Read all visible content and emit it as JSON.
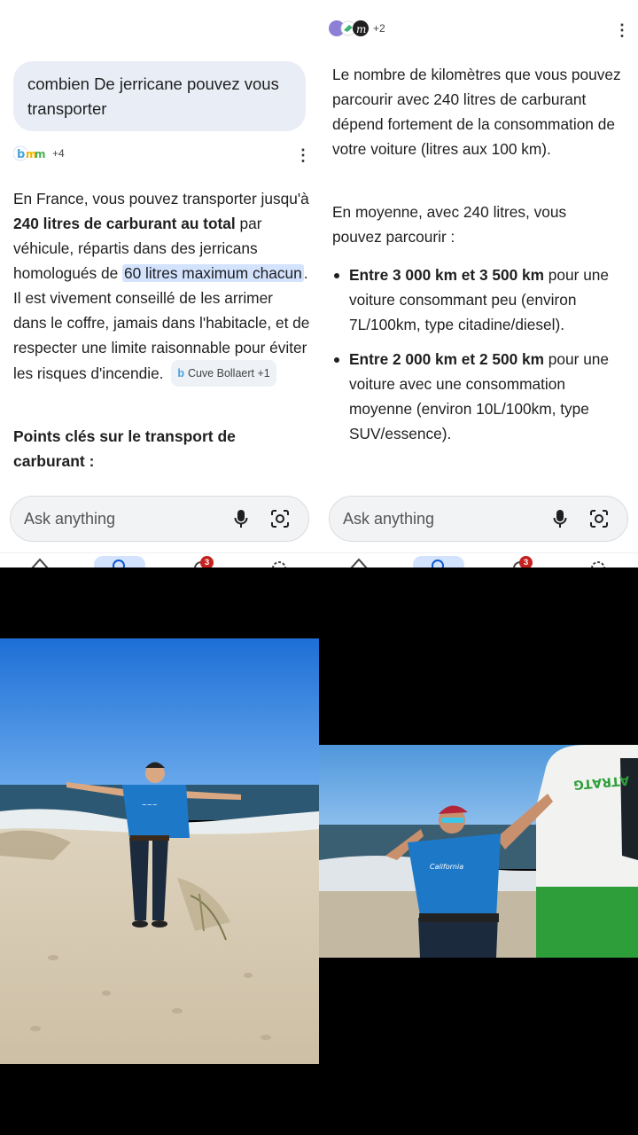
{
  "left": {
    "query": "combien De jerricane pouvez vous transporter",
    "sources_count": "+4",
    "answer": {
      "t1": "En France, vous pouvez transporter jusqu'à ",
      "b1": "240 litres de carburant au total",
      "t2": " par véhicule, répartis dans des jerricans homologués de ",
      "h1": "60 litres maximum chacun",
      "t3": ". Il est vivement conseillé de les arrimer dans le coffre, jamais dans l'habitacle, et de respecter une limite raisonnable pour éviter les risques d'incendie.",
      "chip": "Cuve Bollaert +1"
    },
    "key_points_heading": "Points clés sur le transport de carburant :",
    "ask_placeholder": "Ask anything",
    "nav_badge": "3"
  },
  "right": {
    "sources_count": "+2",
    "p1": "Le nombre de kilomètres que vous pouvez parcourir avec 240 litres de carburant dépend fortement de la consommation de votre voiture (litres aux 100 km).",
    "p2": "En moyenne, avec 240 litres, vous pouvez parcourir :",
    "bullets": [
      {
        "bold": "Entre 3 000 km et 3 500 km",
        "text": " pour une voiture consommant peu (environ 7L/100km, type citadine/diesel)."
      },
      {
        "bold": "Entre 2 000 km et 2 500 km",
        "text": " pour une voiture avec une consommation moyenne (environ 10L/100km, type SUV/essence)."
      }
    ],
    "ask_placeholder": "Ask anything",
    "nav_badge": "3"
  },
  "colors": {
    "accent": "#d3e3fd",
    "badge": "#c5221f",
    "query_bg": "#e9eef6",
    "shirt": "#1e78c8",
    "van_green": "#2e9e3a"
  },
  "icons": [
    "mic-icon",
    "lens-icon",
    "home-icon",
    "search-icon",
    "bell-icon",
    "history-icon",
    "kebab-icon"
  ]
}
